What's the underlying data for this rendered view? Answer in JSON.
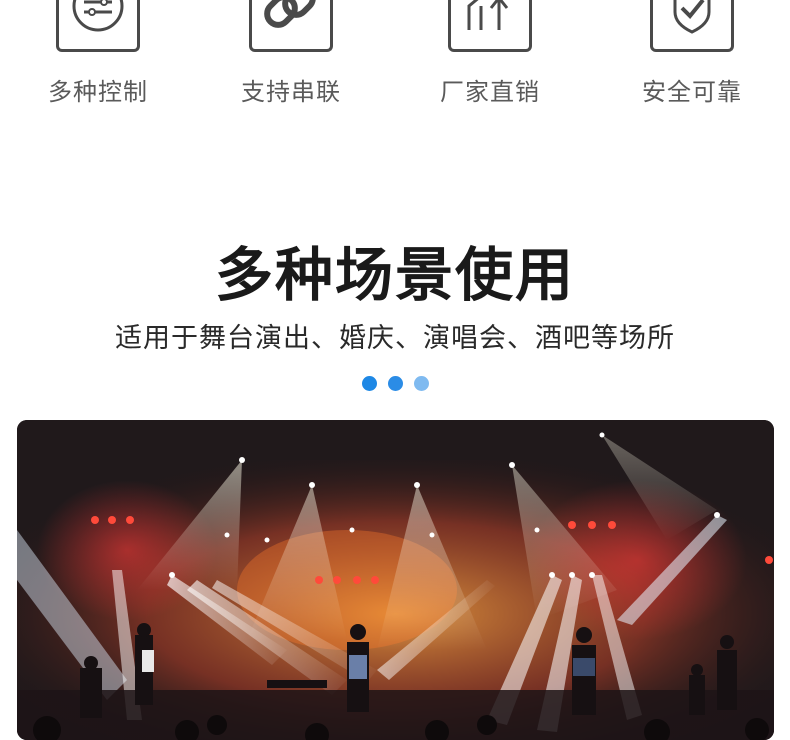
{
  "features": [
    {
      "label": "多种控制",
      "icon": "sliders-icon"
    },
    {
      "label": "支持串联",
      "icon": "link-icon"
    },
    {
      "label": "厂家直销",
      "icon": "factory-icon"
    },
    {
      "label": "安全可靠",
      "icon": "shield-check-icon"
    }
  ],
  "section": {
    "title": "多种场景使用",
    "subtitle": "适用于舞台演出、婚庆、演唱会、酒吧等场所"
  },
  "carousel": {
    "dot_colors": [
      "#1e88e5",
      "#2b8ce6",
      "#7fbaf0"
    ]
  }
}
